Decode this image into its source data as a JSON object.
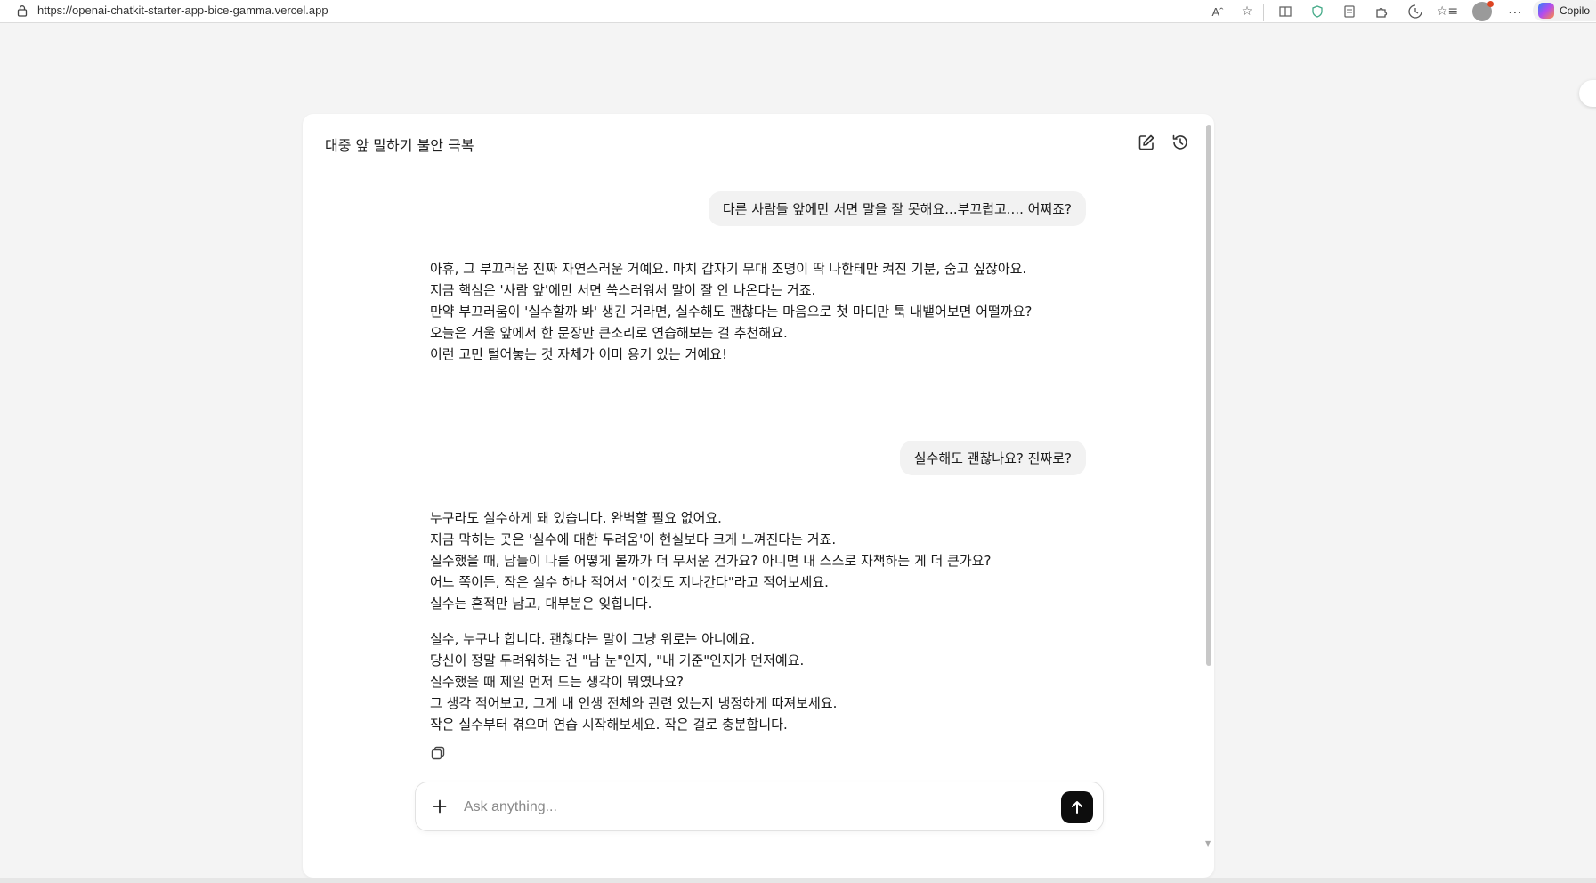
{
  "browser": {
    "url": "https://openai-chatkit-starter-app-bice-gamma.vercel.app",
    "copilot_label": "Copilo",
    "toolbar_icons": [
      "read-aloud-icon",
      "favorite-star-icon",
      "split-screen-icon",
      "shield-icon",
      "reading-view-icon",
      "extensions-icon",
      "browser-essentials-icon",
      "favorites-icon",
      "profile-icon",
      "more-icon",
      "copilot-icon"
    ]
  },
  "chat": {
    "title": "대중 앞 말하기 불안 극복",
    "header_icons": [
      "new-chat-icon",
      "history-icon"
    ],
    "messages": [
      {
        "role": "user",
        "text": "다른 사람들 앞에만 서면 말을 잘 못해요...부끄럽고.... 어쩌죠?"
      },
      {
        "role": "assistant",
        "paragraphs": [
          [
            "아휴, 그 부끄러움 진짜 자연스러운 거예요. 마치 갑자기 무대 조명이 딱 나한테만 켜진 기분, 숨고 싶잖아요.",
            "지금 핵심은 '사람 앞'에만 서면 쑥스러워서 말이 잘 안 나온다는 거죠.",
            "만약 부끄러움이 '실수할까 봐' 생긴 거라면, 실수해도 괜찮다는 마음으로 첫 마디만 툭 내뱉어보면 어떨까요?",
            "오늘은 거울 앞에서 한 문장만 큰소리로 연습해보는 걸 추천해요.",
            "이런 고민 털어놓는 것 자체가 이미 용기 있는 거예요!"
          ]
        ]
      },
      {
        "role": "user",
        "text": "실수해도 괜찮나요? 진짜로?"
      },
      {
        "role": "assistant",
        "paragraphs": [
          [
            "누구라도 실수하게 돼 있습니다. 완벽할 필요 없어요.",
            "지금 막히는 곳은 '실수에 대한 두려움'이 현실보다 크게 느껴진다는 거죠.",
            "실수했을 때, 남들이 나를 어떻게 볼까가 더 무서운 건가요? 아니면 내 스스로 자책하는 게 더 큰가요?",
            "어느 쪽이든, 작은 실수 하나 적어서 \"이것도 지나간다\"라고 적어보세요.",
            "실수는 흔적만 남고, 대부분은 잊힙니다."
          ],
          [
            "실수, 누구나 합니다. 괜찮다는 말이 그냥 위로는 아니에요.",
            "당신이 정말 두려워하는 건 \"남 눈\"인지, \"내 기준\"인지가 먼저예요.",
            "실수했을 때 제일 먼저 드는 생각이 뭐였나요?",
            "그 생각 적어보고, 그게 내 인생 전체와 관련 있는지 냉정하게 따져보세요.",
            "작은 실수부터 겪으며 연습 시작해보세요. 작은 걸로 충분합니다."
          ]
        ]
      }
    ]
  },
  "composer": {
    "placeholder": "Ask anything..."
  }
}
